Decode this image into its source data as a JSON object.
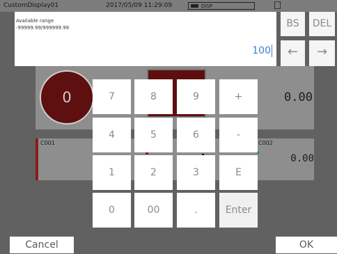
{
  "background": {
    "title": "CustomDisplay01",
    "datetime": "2017/05/09 11:29:09",
    "disp_label": "DISP",
    "circle_value": "0",
    "tag_c001": "C001",
    "tag_c002": "C002",
    "value_top_right": "0.00",
    "value_mid_right": "0.00"
  },
  "dialog": {
    "range_label": "Available range",
    "range_value": "-99999.99/999999.99",
    "entry_value": "100"
  },
  "side_keys": {
    "bs": "BS",
    "del": "DEL",
    "left_arrow": "←",
    "right_arrow": "→"
  },
  "keypad": {
    "keys": [
      "7",
      "8",
      "9",
      "+",
      "4",
      "5",
      "6",
      "-",
      "1",
      "2",
      "3",
      "E",
      "0",
      "00",
      ".",
      "Enter"
    ]
  },
  "buttons": {
    "cancel": "Cancel",
    "ok": "OK"
  },
  "colors": {
    "background": "#616161",
    "entry_text": "#3d7fd0",
    "indicator_dark_red": "#5e0f0f"
  }
}
